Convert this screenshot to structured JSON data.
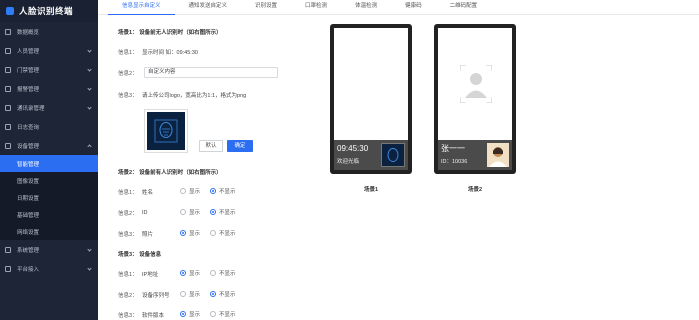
{
  "app": {
    "title": "人脸识别终端",
    "accent": "#2c6ef2",
    "sidebar_bg": "#1d2536"
  },
  "sidebar": {
    "items": [
      {
        "label": "数据概览",
        "icon": "dashboard-icon"
      },
      {
        "label": "人员管理",
        "icon": "user-icon"
      },
      {
        "label": "门禁管理",
        "icon": "door-icon"
      },
      {
        "label": "报警管理",
        "icon": "alarm-icon"
      },
      {
        "label": "通讯录管理",
        "icon": "contacts-icon"
      },
      {
        "label": "日志查询",
        "icon": "log-icon"
      },
      {
        "label": "设备管理",
        "icon": "device-icon"
      }
    ],
    "sub_items": [
      {
        "label": "智能管理",
        "active": true
      },
      {
        "label": "图像设置",
        "active": false
      },
      {
        "label": "日期设置",
        "active": false
      },
      {
        "label": "基础管理",
        "active": false
      },
      {
        "label": "网络设置",
        "active": false
      }
    ],
    "bottom_items": [
      {
        "label": "系统管理",
        "icon": "system-icon"
      },
      {
        "label": "平台接入",
        "icon": "platform-icon"
      }
    ]
  },
  "tabs": [
    {
      "label": "信息显示自定义",
      "active": true
    },
    {
      "label": "通知发送自定义",
      "active": false
    },
    {
      "label": "识别设置",
      "active": false
    },
    {
      "label": "口罩检测",
      "active": false
    },
    {
      "label": "体温检测",
      "active": false
    },
    {
      "label": "健康码",
      "active": false
    },
    {
      "label": "二维码配置",
      "active": false
    }
  ],
  "scene1": {
    "title": "场景1：    设备前无人识别时（如右图所示）",
    "info1_label": "信息1：",
    "info1_value": "显示时间 如：09:45:30",
    "info2_label": "信息2：",
    "info2_value": "自定义内容",
    "info3_label": "信息3：",
    "info3_value": "请上传公司logo，宽高比为1:1，格式为png",
    "reset_label": "默认",
    "confirm_label": "确定"
  },
  "scene2": {
    "title": "场景2：    设备前有人识别时（如右图所示）",
    "rows": [
      {
        "label": "信息1：",
        "field": "姓名",
        "show": "显示",
        "hide": "不显示",
        "selected": "hide"
      },
      {
        "label": "信息2：",
        "field": "ID",
        "show": "显示",
        "hide": "不显示",
        "selected": "hide"
      },
      {
        "label": "信息3：",
        "field": "照片",
        "show": "显示",
        "hide": "不显示",
        "selected": "show"
      }
    ]
  },
  "scene3": {
    "title": "场景3：    设备信息",
    "rows": [
      {
        "label": "信息1：",
        "field": "IP地址",
        "show": "显示",
        "hide": "不显示",
        "selected": "show"
      },
      {
        "label": "信息2：",
        "field": "设备序列号",
        "show": "显示",
        "hide": "不显示",
        "selected": "hide"
      },
      {
        "label": "信息3：",
        "field": "软件版本",
        "show": "显示",
        "hide": "不显示",
        "selected": "show"
      }
    ]
  },
  "preview1": {
    "time": "09:45:30",
    "welcome": "欢迎光临",
    "caption": "场景1"
  },
  "preview2": {
    "name": "张一一",
    "id": "ID：10036",
    "caption": "场景2"
  }
}
